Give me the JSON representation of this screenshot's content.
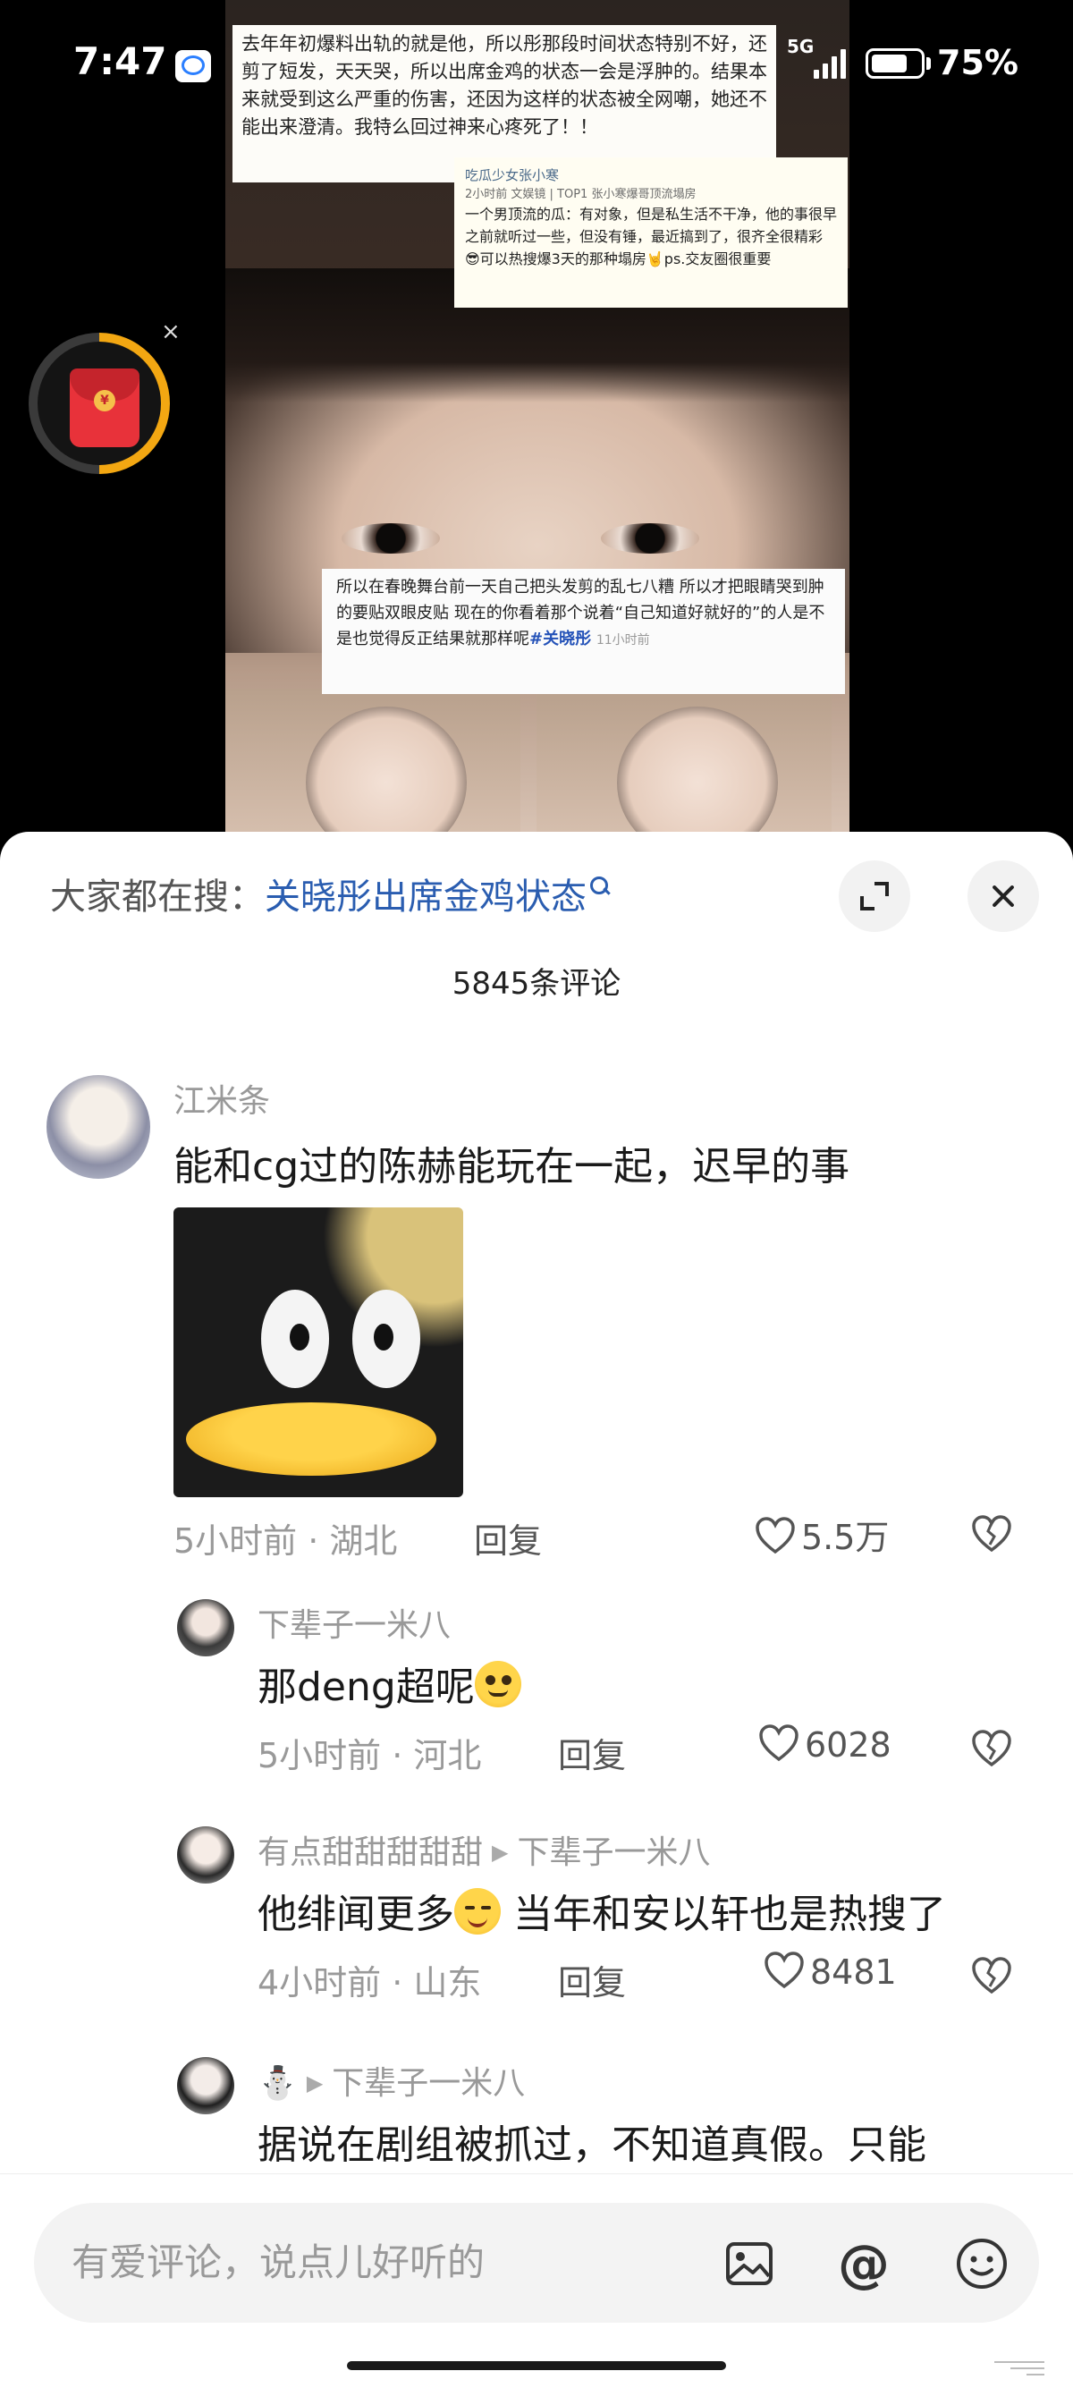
{
  "status_bar": {
    "time": "7:47",
    "network": "5G",
    "battery_percent": "75%",
    "battery_level": 0.75
  },
  "video": {
    "caption_top": "去年年初爆料出轨的就是他，所以彤那段时间状态特别不好，还剪了短发，天天哭，所以出席金鸡的状态一会是浮肿的。结果本来就受到这么严重的伤害，还因为这样的状态被全网嘲，她还不能出来澄清。我特么回过神来心疼死了！！",
    "caption_mid_user": "吃瓜少女张小寒",
    "caption_mid_meta": "2小时前  文娱镜 | TOP1 张小寒爆哥顶流塌房",
    "caption_mid_body": "一个男顶流的瓜：有对象，但是私生活不干净，他的事很早之前就听过一些，但没有锤，最近搞到了，很齐全很精彩😎可以热搜爆3天的那种塌房🤘ps.交友圈很重要",
    "caption_bottom": "所以在春晚舞台前一天自己把头发剪的乱七八糟 所以才把眼睛哭到肿的要贴双眼皮贴 现在的你看着那个说着“自己知道好就好的”的人是不是也觉得反正结果就那样呢",
    "caption_bottom_tag": "#关晓彤",
    "caption_bottom_time": "11小时前"
  },
  "red_packet": {
    "icon": "red-envelope-icon",
    "coin_symbol": "¥",
    "close": "×",
    "progress": 0.5
  },
  "sheet": {
    "search_prefix": "大家都在搜：",
    "search_term": "关晓彤出席金鸡状态",
    "comment_count": "5845条评论"
  },
  "comments": [
    {
      "author": "江米条",
      "text": "能和cg过的陈赫能玩在一起，迟早的事",
      "time_location": "5小时前 · 湖北",
      "reply": "回复",
      "likes": "5.5万",
      "sticker": "penguin-sticker"
    },
    {
      "author": "下辈子一米八",
      "text": "那deng超呢",
      "time_location": "5小时前 · 河北",
      "reply": "回复",
      "likes": "6028"
    },
    {
      "author": "有点甜甜甜甜甜",
      "reply_to": "下辈子一米八",
      "text": "他绯闻更多",
      "text_after_emoji": " 当年和安以轩也是热搜了",
      "time_location": "4小时前 · 山东",
      "reply": "回复",
      "likes": "8481"
    },
    {
      "author": "⛄",
      "reply_to": "下辈子一米八",
      "text": "据说在剧组被抓过，不知道真假。只能"
    }
  ],
  "input": {
    "placeholder": "有爱评论，说点儿好听的",
    "at_symbol": "@"
  },
  "colors": {
    "accent_blue": "#2a5db0",
    "red_packet": "#e8323a",
    "progress_ring": "#f3a712"
  }
}
